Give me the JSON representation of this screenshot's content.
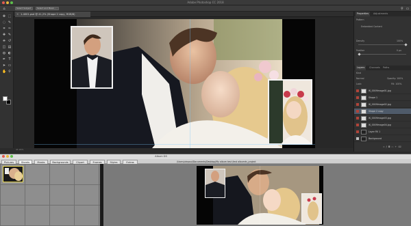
{
  "photoshop": {
    "window_title": "Adobe Photoshop CC 2018",
    "options": [
      "Select Subject",
      "Select and Mask..."
    ],
    "document_tab": "1-4001.psd @ 41,2% (Shape 2 copy, RGB/8)",
    "status": "41,24%",
    "tools": [
      "move-tool",
      "marquee-tool",
      "lasso-tool",
      "quick-select-tool",
      "crop-tool",
      "eyedropper-tool",
      "healing-tool",
      "brush-tool",
      "stamp-tool",
      "history-brush-tool",
      "eraser-tool",
      "gradient-tool",
      "blur-tool",
      "dodge-tool",
      "pen-tool",
      "type-tool",
      "path-select-tool",
      "shape-tool",
      "hand-tool",
      "zoom-tool"
    ],
    "panels": {
      "top_tabs": [
        "Properties",
        "Adjustments"
      ],
      "properties": {
        "title": "Pattern",
        "row1": "Embedded Content",
        "label_density": "Density",
        "label_feather": "Feather",
        "density_value": "100%",
        "feather_value": "0 px"
      },
      "layers_tabs": [
        "Layers",
        "Channels",
        "Paths"
      ],
      "kind_filter": "Kind",
      "blend_mode": "Normal",
      "opacity": "Opacity: 100%",
      "lock": "Lock:",
      "fill": "Fill: 100%",
      "layers": [
        {
          "name": "IK_0009Image01.jpg",
          "visible": false,
          "dark": false
        },
        {
          "name": "Shape 1",
          "visible": false,
          "dark": false
        },
        {
          "name": "IK_0009Image02.jpg",
          "visible": false,
          "dark": false
        },
        {
          "name": "Shape 2 copy",
          "visible": false,
          "dark": false,
          "selected": true
        },
        {
          "name": "IK_0009Image03.jpg",
          "visible": false,
          "dark": false
        },
        {
          "name": "IK_0009Image04.jpg",
          "visible": false,
          "dark": false
        },
        {
          "name": "Layer Fill 1",
          "visible": false,
          "dark": true
        },
        {
          "name": "Background",
          "visible": true,
          "dark": true
        }
      ]
    }
  },
  "album_ds": {
    "window_title": "Album DS",
    "path": "/Users/alepaul/Documents/Desktop/My album test /test albumds_project",
    "tabs": [
      "Pictures",
      "Sheets",
      "Masks",
      "Backgrounds",
      "Clipart",
      "Frames",
      "Styles",
      "Extras"
    ],
    "active_tab": "Sheets"
  },
  "colors": {
    "ps_bg": "#2b2b2b",
    "canvas_black": "#050505",
    "layer_selected": "#4f5b6a",
    "eye_red": "#b0443a"
  }
}
